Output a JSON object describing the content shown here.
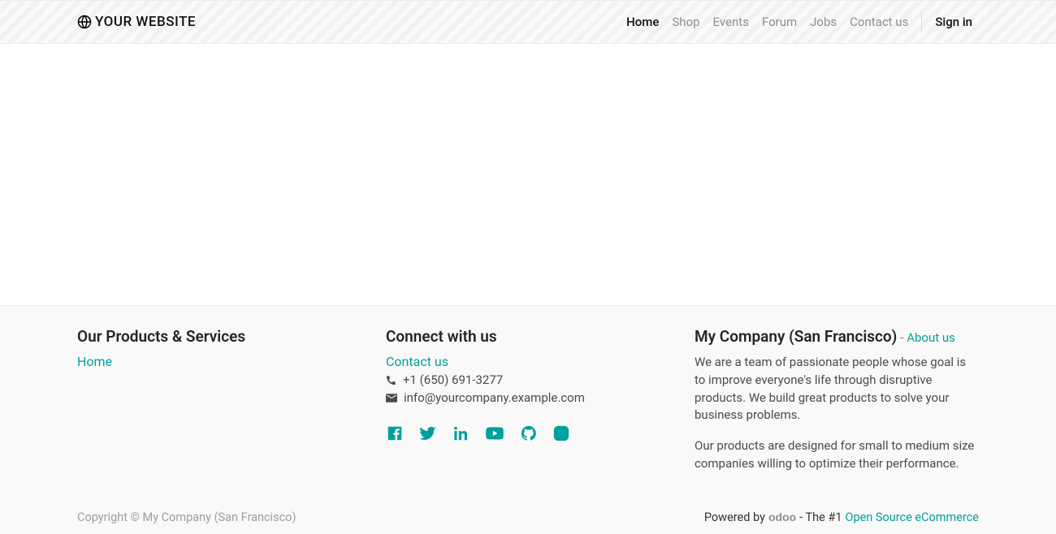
{
  "header": {
    "brand": "YOUR WEBSITE",
    "nav": {
      "home": "Home",
      "shop": "Shop",
      "events": "Events",
      "forum": "Forum",
      "jobs": "Jobs",
      "contact": "Contact us",
      "signin": "Sign in"
    }
  },
  "footer": {
    "col1": {
      "heading": "Our Products & Services",
      "link_home": "Home"
    },
    "col2": {
      "heading": "Connect with us",
      "contact_link": "Contact us",
      "phone": "+1 (650) 691-3277",
      "email": "info@yourcompany.example.com"
    },
    "col3": {
      "company": "My Company (San Francisco)",
      "sep": " - ",
      "about": "About us",
      "p1": "We are a team of passionate people whose goal is to improve everyone's life through disruptive products. We build great products to solve your business problems.",
      "p2": "Our products are designed for small to medium size companies willing to optimize their performance."
    },
    "lower": {
      "copyright": "Copyright © My Company (San Francisco)",
      "powered": "Powered by",
      "odoo": "odoo",
      "dash": " - The #1 ",
      "oss": "Open Source eCommerce"
    }
  }
}
